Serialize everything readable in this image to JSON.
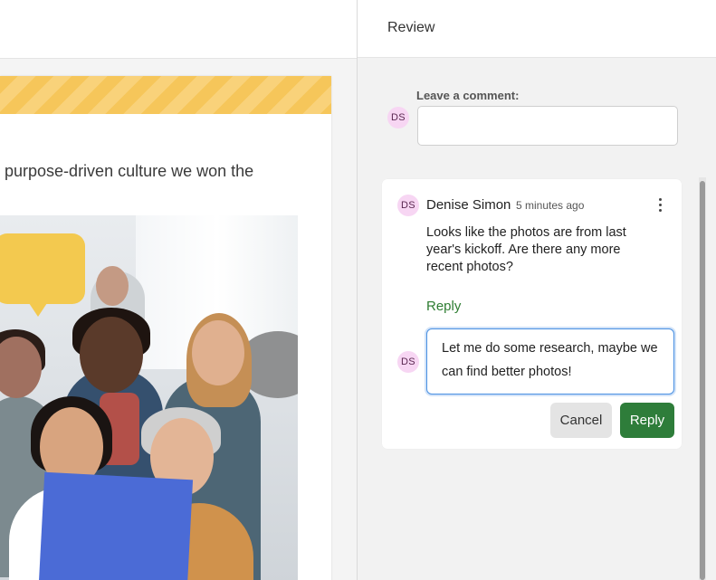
{
  "document": {
    "visible_text": "d purpose-driven culture we won the"
  },
  "review": {
    "title": "Review",
    "leave_comment_label": "Leave a comment:",
    "comment_input_value": "",
    "current_user_initials": "DS",
    "thread": {
      "author_initials": "DS",
      "author_name": "Denise Simon",
      "time_ago": "5 minutes ago",
      "body": "Looks like the photos are from last year's kickoff. Are there any more recent photos?",
      "reply_link_label": "Reply",
      "reply_user_initials": "DS",
      "reply_draft": "Let me do some research, maybe we can find better photos!",
      "cancel_label": "Cancel",
      "reply_button_label": "Reply"
    }
  },
  "colors": {
    "accent_green": "#2e7d3a",
    "avatar_bg": "#f7d6f3",
    "banner_yellow": "#f6c65a",
    "focus_blue": "#4a90e2"
  },
  "icons": {
    "more_options": "vertical-ellipsis-icon"
  }
}
